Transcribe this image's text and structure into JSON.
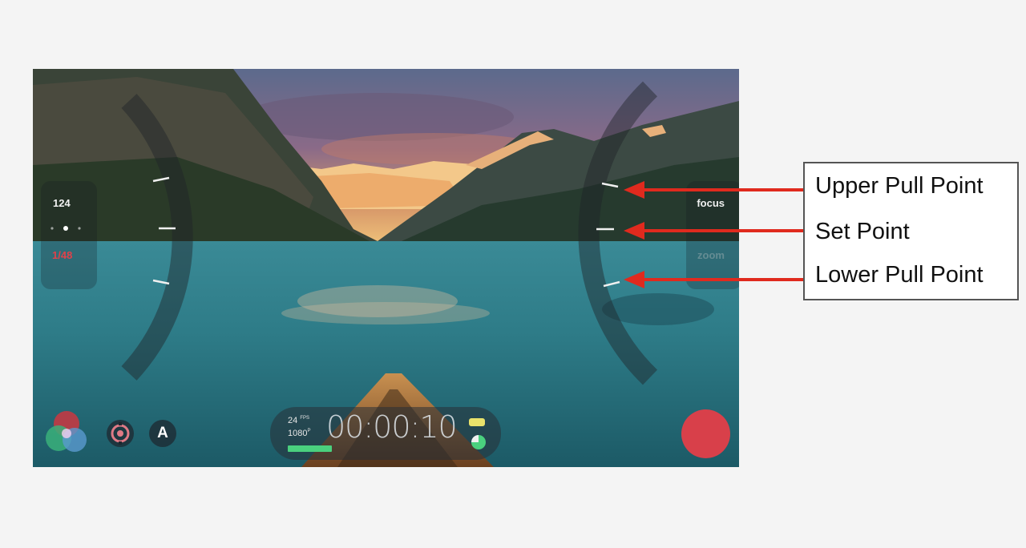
{
  "hud": {
    "iso": "124",
    "shutter": "1/48",
    "focus_label": "focus",
    "zoom_label": "zoom",
    "fps_value": "24",
    "fps_unit": "FPS",
    "resolution_value": "1080",
    "resolution_unit": "P",
    "timecode": "00:00:10"
  },
  "callouts": {
    "upper": "Upper Pull Point",
    "set": "Set Point",
    "lower": "Lower Pull Point"
  },
  "colors": {
    "record": "#d8404a",
    "arrow": "#e02a1e",
    "shutter_text": "#e0414a",
    "record_bar": "#4ad07e",
    "battery": "#e9e26b"
  },
  "icons": [
    "color-wheel-icon",
    "stabilizer-icon",
    "auto-mode-icon",
    "battery-icon",
    "storage-icon",
    "record-icon",
    "arrow-icon"
  ]
}
